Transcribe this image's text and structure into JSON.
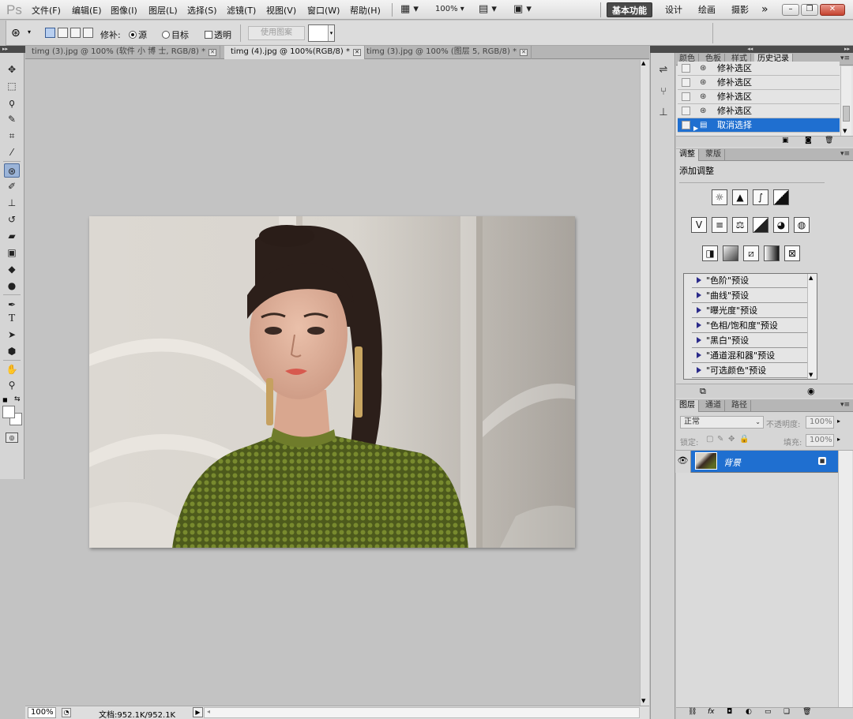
{
  "app": {
    "logo": "Ps"
  },
  "menu": [
    "文件(F)",
    "编辑(E)",
    "图像(I)",
    "图层(L)",
    "选择(S)",
    "滤镜(T)",
    "视图(V)",
    "窗口(W)",
    "帮助(H)"
  ],
  "menubar_tools": {
    "zoom": "100%"
  },
  "workspaces": {
    "basic": "基本功能",
    "design": "设计",
    "paint": "绘画",
    "photo": "摄影",
    "more": "»"
  },
  "options": {
    "patch_label": "修补:",
    "source_label": "源",
    "target_label": "目标",
    "transparent_label": "透明",
    "use_pattern_label": "使用图案"
  },
  "tabs": [
    {
      "label": "timg (3).jpg @ 100% (软件 小 博 士, RGB/8) *"
    },
    {
      "label": "timg (4).jpg @ 100%(RGB/8) *"
    },
    {
      "label": "timg (3).jpg @ 100% (图层 5, RGB/8) *"
    }
  ],
  "status": {
    "zoom": "100%",
    "doc_info": "文档:952.1K/952.1K"
  },
  "history_panel": {
    "tabs": [
      "颜色",
      "色板",
      "样式",
      "历史记录"
    ],
    "items": [
      {
        "label": "修补选区"
      },
      {
        "label": "修补选区"
      },
      {
        "label": "修补选区"
      },
      {
        "label": "修补选区"
      },
      {
        "label": "取消选择"
      }
    ]
  },
  "adjust_panel": {
    "tabs": [
      "调整",
      "蒙版"
    ],
    "title": "添加调整",
    "presets": [
      "\"色阶\"预设",
      "\"曲线\"预设",
      "\"曝光度\"预设",
      "\"色相/饱和度\"预设",
      "\"黑白\"预设",
      "\"通道混和器\"预设",
      "\"可选颜色\"预设"
    ]
  },
  "layers_panel": {
    "tabs": [
      "图层",
      "通道",
      "路径"
    ],
    "blend_mode": "正常",
    "opacity_label": "不透明度:",
    "opacity": "100%",
    "lock_label": "锁定:",
    "fill_label": "填充:",
    "fill": "100%",
    "layer_name": "背景"
  },
  "colors": {
    "selection_blue": "#1f6fd0",
    "canvas_gray": "#c3c3c3",
    "active_workspace": "#4a4a4a"
  }
}
